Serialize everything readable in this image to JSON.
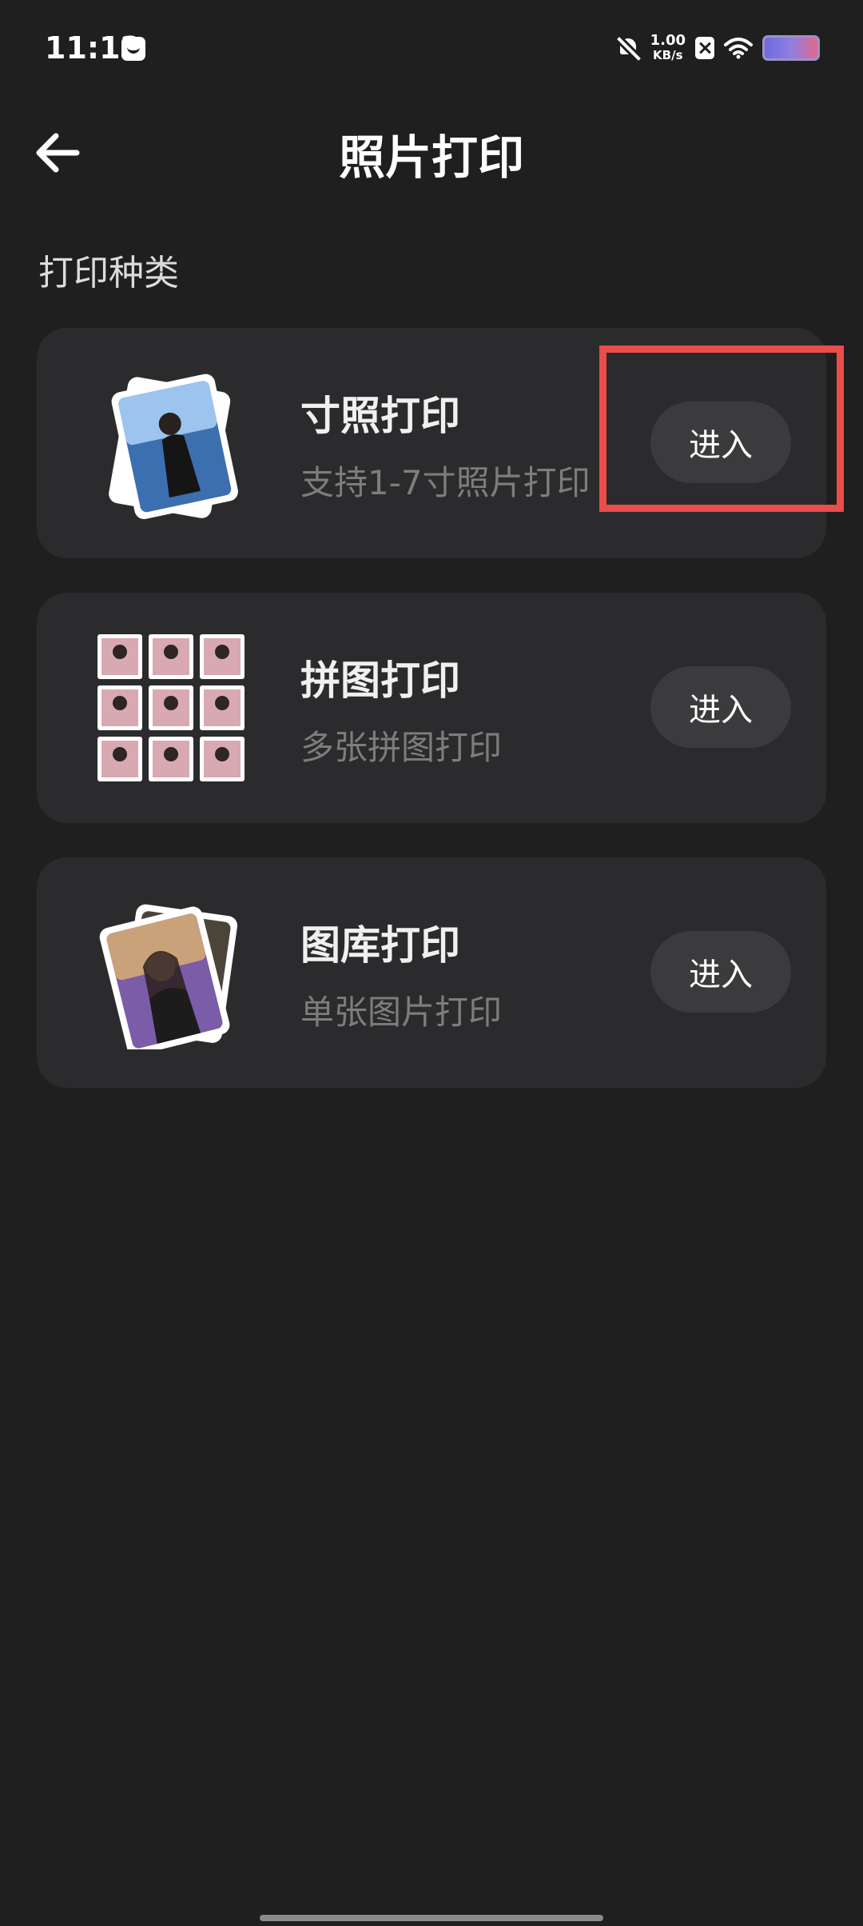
{
  "status_bar": {
    "time": "11:12",
    "net_speed_value": "1.00",
    "net_speed_unit": "KB/s"
  },
  "app_bar": {
    "title": "照片打印"
  },
  "section": {
    "title": "打印种类"
  },
  "cards": [
    {
      "name": "寸照打印",
      "desc": "支持1-7寸照片打印",
      "button": "进入",
      "thumb_icon": "single-photo-thumbnail"
    },
    {
      "name": "拼图打印",
      "desc": "多张拼图打印",
      "button": "进入",
      "thumb_icon": "photo-grid-thumbnail"
    },
    {
      "name": "图库打印",
      "desc": "单张图片打印",
      "button": "进入",
      "thumb_icon": "stacked-photos-thumbnail"
    }
  ],
  "colors": {
    "background": "#1f1f1f",
    "card": "#2b2b2d",
    "button": "#3b3b3d",
    "highlight": "#ea4d4a"
  }
}
